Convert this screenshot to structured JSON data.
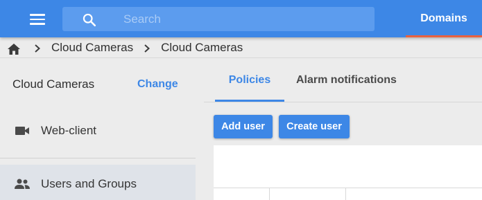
{
  "topbar": {
    "menu_icon": "hamburger-menu-icon",
    "search": {
      "icon": "search-icon",
      "placeholder": "Search",
      "value": ""
    },
    "domains_label": "Domains",
    "colors": {
      "bar": "#3d87e6",
      "search_bg": "#5c9cee",
      "domains_underline": "#e8613f"
    }
  },
  "breadcrumb": {
    "home_icon": "home-icon",
    "items": [
      "Cloud Cameras",
      "Cloud Cameras"
    ]
  },
  "sidebar": {
    "title": "Cloud Cameras",
    "change_label": "Change",
    "items": [
      {
        "icon": "videocam-icon",
        "label": "Web-client",
        "selected": false
      },
      {
        "icon": "people-icon",
        "label": "Users and Groups",
        "selected": true
      }
    ]
  },
  "main": {
    "tabs": [
      {
        "label": "Policies",
        "active": true
      },
      {
        "label": "Alarm notifications",
        "active": false
      }
    ],
    "actions": {
      "add_user_label": "Add user",
      "create_user_label": "Create user"
    }
  }
}
